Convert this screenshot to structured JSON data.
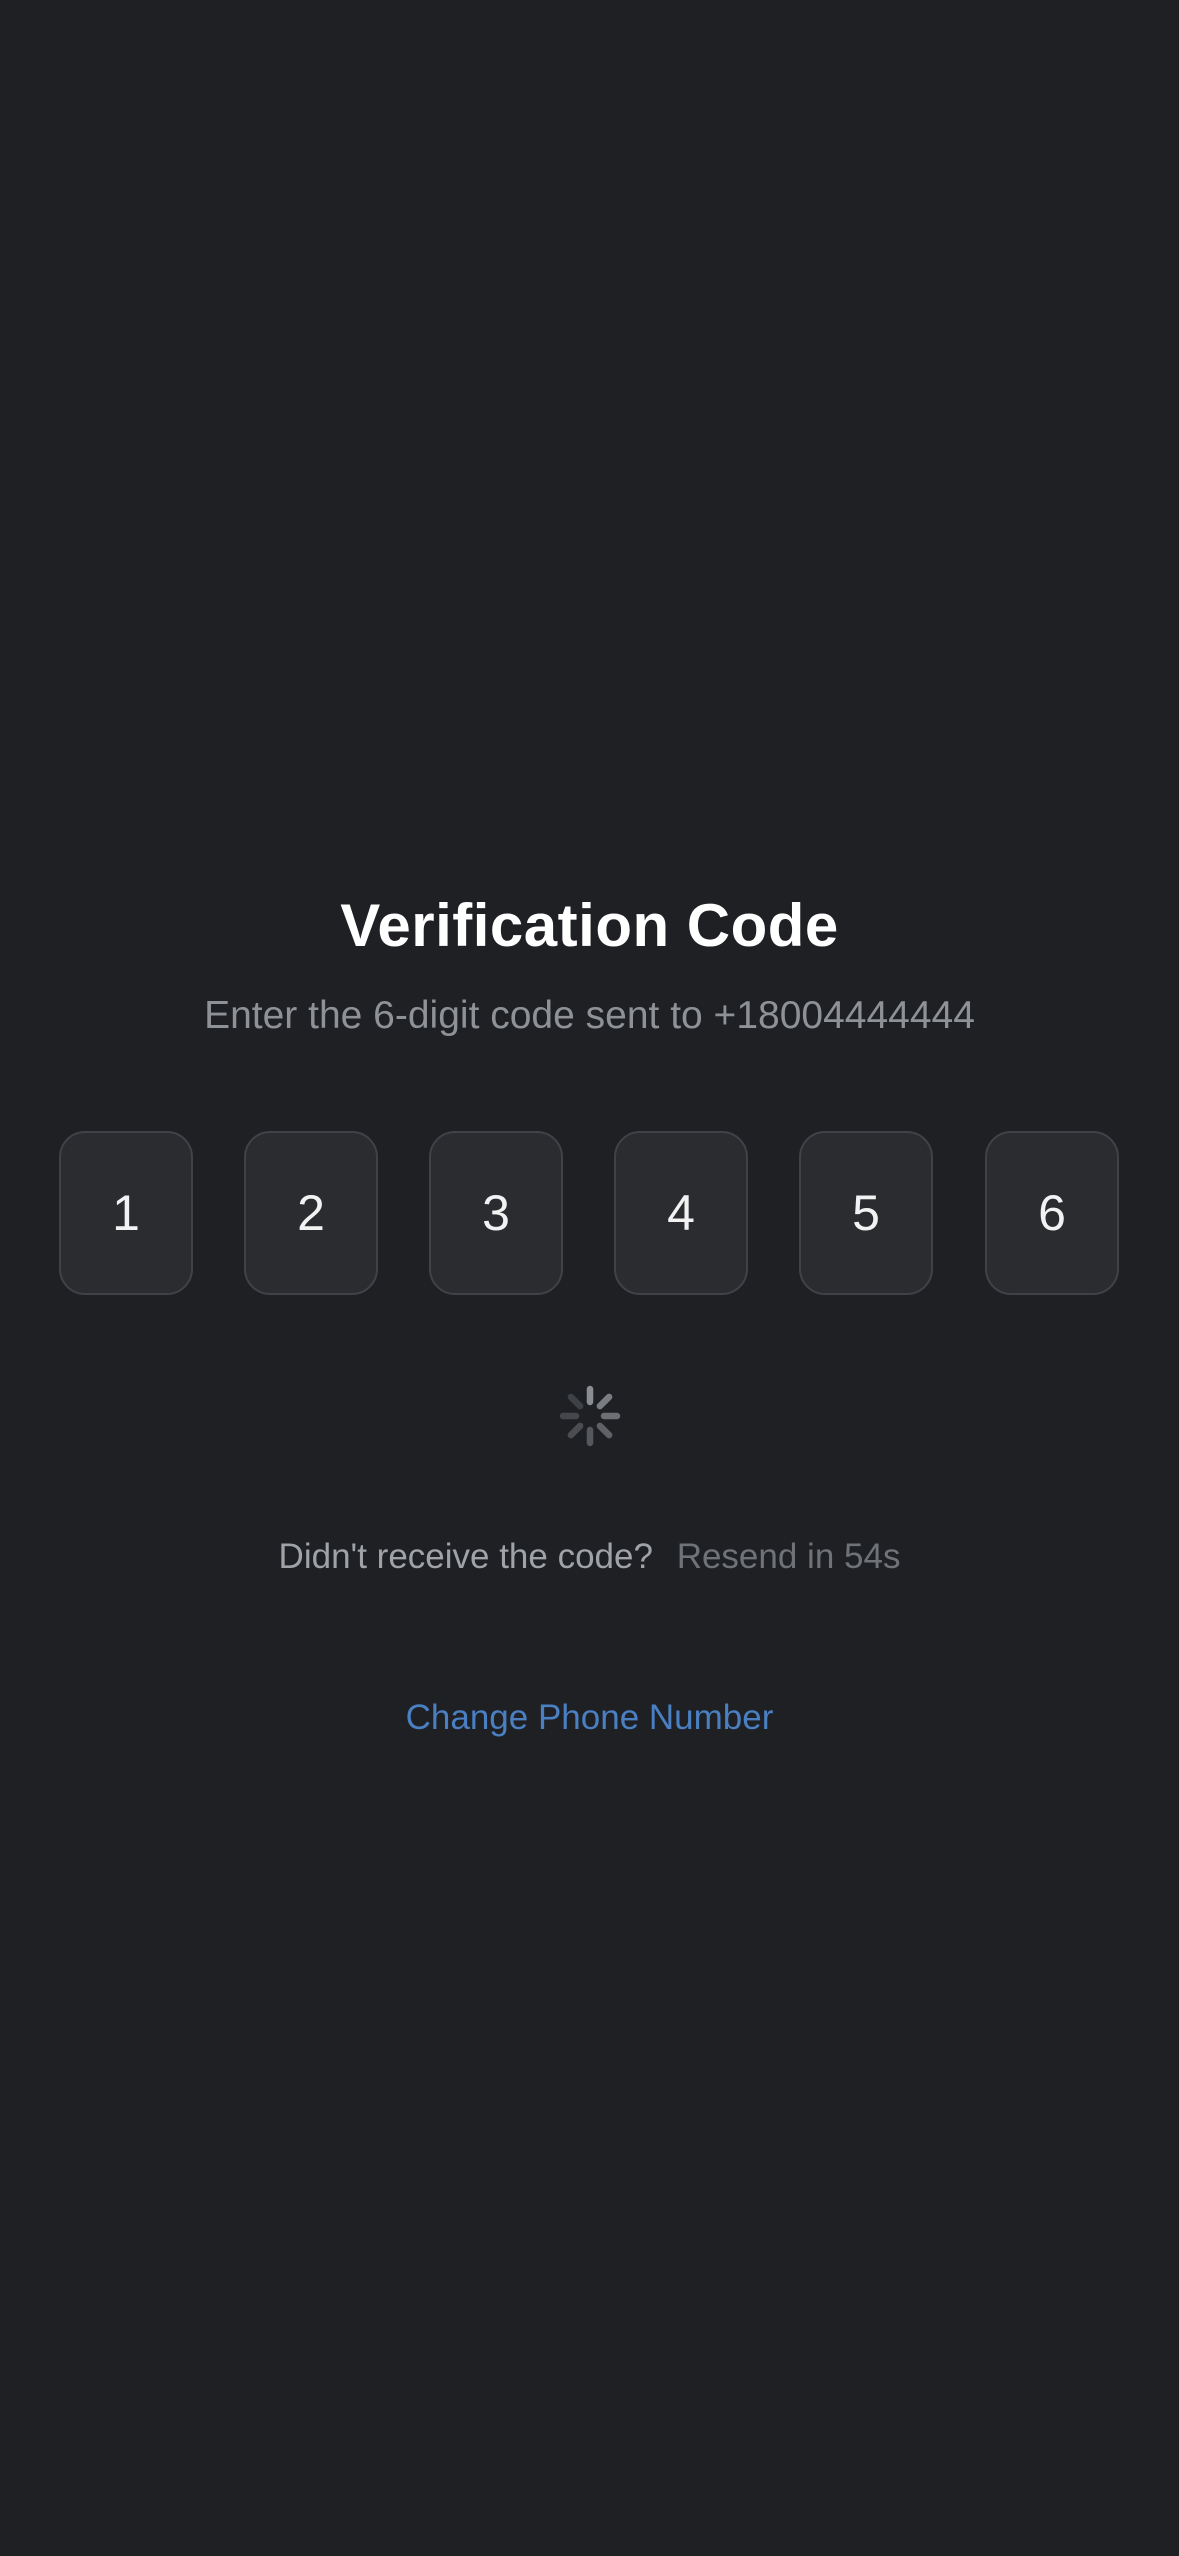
{
  "header": {
    "title": "Verification Code",
    "subtitle": "Enter the 6-digit code sent to +18004444444"
  },
  "code": {
    "digits": [
      "1",
      "2",
      "3",
      "4",
      "5",
      "6"
    ]
  },
  "loading": {
    "icon": "spinner-icon"
  },
  "resend": {
    "prompt": "Didn't receive the code?",
    "timer": "Resend in 54s"
  },
  "actions": {
    "change_phone_label": "Change Phone Number"
  },
  "colors": {
    "background": "#1e2024",
    "box_fill": "#2a2c30",
    "box_border": "#3f4246",
    "subtitle_text": "#8e9196",
    "muted_text": "#6f7277",
    "link_blue": "#4a7fc1"
  }
}
